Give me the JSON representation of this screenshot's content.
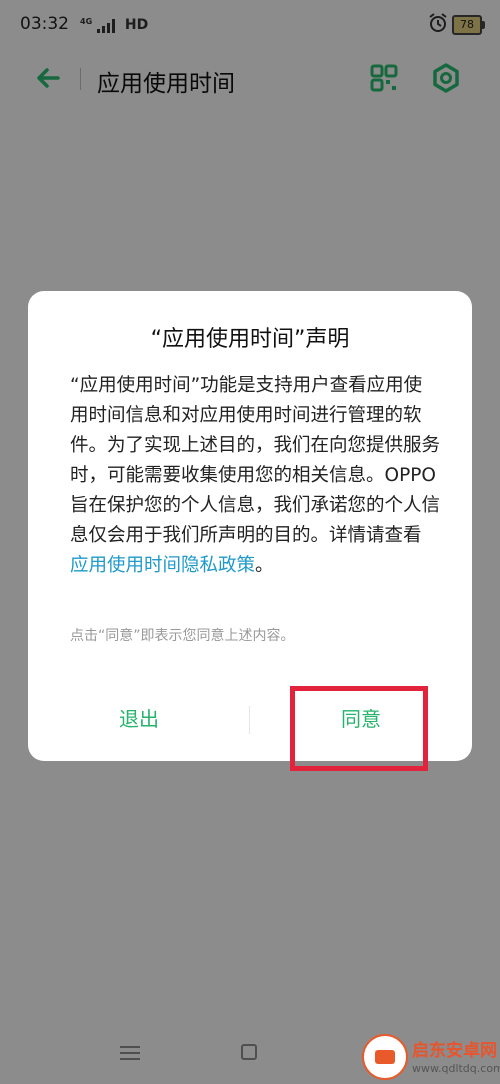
{
  "status_bar": {
    "time": "03:32",
    "network": "HD",
    "network_small": "4G",
    "battery": "78"
  },
  "header": {
    "title": "应用使用时间"
  },
  "dialog": {
    "title": "“应用使用时间”声明",
    "body": "“应用使用时间”功能是支持用户查看应用使用时间信息和对应用使用时间进行管理的软件。为了实现上述目的，我们在向您提供服务时，可能需要收集使用您的相关信息。OPPO 旨在保护您的个人信息，我们承诺您的个人信息仅会用于我们所声明的目的。详情请查看",
    "link": "应用使用时间隐私政策",
    "body_end": "。",
    "note": "点击“同意”即表示您同意上述内容。",
    "exit_label": "退出",
    "agree_label": "同意"
  },
  "watermark": {
    "text": "启东安卓网",
    "url": "www.qdltdq.com"
  },
  "colors": {
    "accent_green": "#26b36b",
    "link_blue": "#1f9ac9",
    "highlight_red": "#e3223b"
  }
}
